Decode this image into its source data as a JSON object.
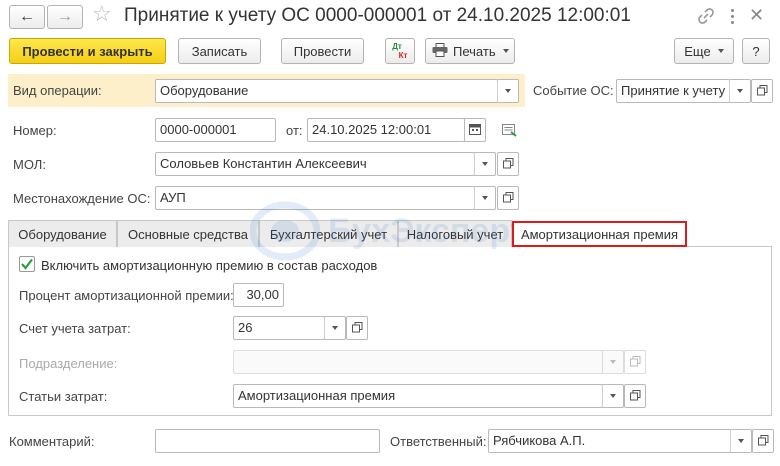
{
  "window": {
    "title": "Принятие к учету ОС 0000-000001 от 24.10.2025 12:00:01"
  },
  "toolbar": {
    "post_close": "Провести и закрыть",
    "write": "Записать",
    "post": "Провести",
    "dtkt_top": "Дт",
    "dtkt_bottom": "Кт",
    "print": "Печать",
    "more": "Еще",
    "help": "?"
  },
  "form": {
    "op_type_label": "Вид операции:",
    "op_type_value": "Оборудование",
    "event_label": "Событие ОС:",
    "event_value": "Принятие к учету",
    "number_label": "Номер:",
    "number_value": "0000-000001",
    "date_label": "от:",
    "date_value": "24.10.2025 12:00:01",
    "mol_label": "МОЛ:",
    "mol_value": "Соловьев Константин Алексеевич",
    "location_label": "Местонахождение ОС:",
    "location_value": "АУП"
  },
  "tabs": [
    {
      "label": "Оборудование"
    },
    {
      "label": "Основные средства"
    },
    {
      "label": "Бухгалтерский учет"
    },
    {
      "label": "Налоговый учет"
    },
    {
      "label": "Амортизационная премия"
    }
  ],
  "premium": {
    "include_label": "Включить амортизационную премию в состав расходов",
    "include_checked": true,
    "percent_label": "Процент амортизационной премии:",
    "percent_value": "30,00",
    "account_label": "Счет учета затрат:",
    "account_value": "26",
    "division_label": "Подразделение:",
    "division_value": "",
    "cost_label": "Статьи затрат:",
    "cost_value": "Амортизационная премия"
  },
  "footer": {
    "comment_label": "Комментарий:",
    "comment_value": "",
    "responsible_label": "Ответственный:",
    "responsible_value": "Рябчикова А.П."
  },
  "watermark": "БухЭксперт",
  "colors": {
    "primary_button": "#f5cf14",
    "highlight_row": "#fdefc9",
    "active_tab_border": "#e01a1a",
    "checkbox_check": "#2e9e3e"
  }
}
